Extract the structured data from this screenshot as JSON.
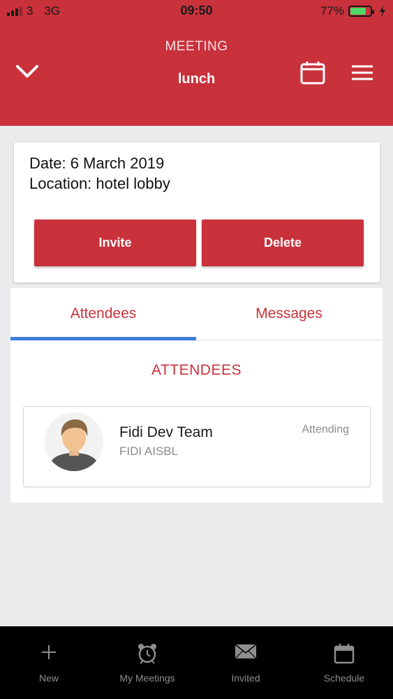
{
  "status_bar": {
    "carrier": "3",
    "network": "3G",
    "time": "09:50",
    "battery_percent": "77%",
    "battery_level": 0.77
  },
  "header": {
    "title": "MEETING",
    "subtitle": "lunch"
  },
  "meeting": {
    "date_line": "Date: 6 March 2019",
    "location_line": "Location: hotel lobby",
    "invite_label": "Invite",
    "delete_label": "Delete"
  },
  "tabs": {
    "items": [
      {
        "label": "Attendees",
        "active": true
      },
      {
        "label": "Messages",
        "active": false
      }
    ]
  },
  "attendees_section": {
    "title": "ATTENDEES",
    "items": [
      {
        "name": "Fidi Dev Team",
        "organization": "FIDI AISBL",
        "status": "Attending"
      }
    ]
  },
  "tab_bar": {
    "items": [
      {
        "label": "New",
        "icon": "plus-icon"
      },
      {
        "label": "My Meetings",
        "icon": "alarm-clock-icon"
      },
      {
        "label": "Invited",
        "icon": "envelope-icon"
      },
      {
        "label": "Schedule",
        "icon": "calendar-icon"
      }
    ]
  },
  "colors": {
    "brand_red": "#c9313b",
    "tab_indicator": "#3b7ddd",
    "battery_green": "#4cd964"
  }
}
